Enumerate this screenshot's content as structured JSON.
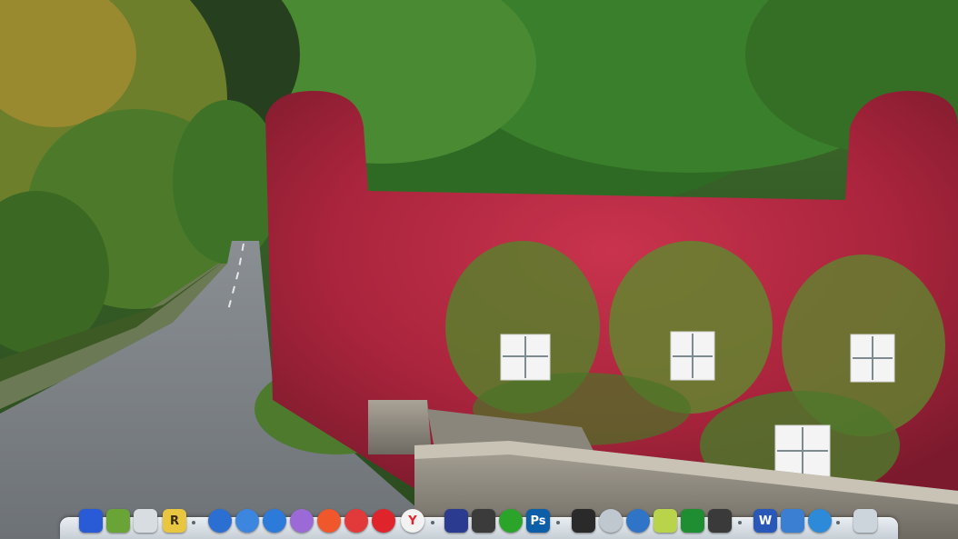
{
  "desktop": {
    "wallpaper": "ivy-covered-cottage-by-road"
  },
  "dock": {
    "items": [
      {
        "icon": "finder-icon",
        "color": "#2a5bd7"
      },
      {
        "icon": "gourd-icon",
        "color": "#6aa336"
      },
      {
        "icon": "mail-icon",
        "color": "#d8dde2"
      },
      {
        "icon": "r-app-icon",
        "color": "#e9c640",
        "glyph": "R"
      },
      {
        "icon": "firefox-icon",
        "color": "#2b6fd2"
      },
      {
        "icon": "globe-browser-icon",
        "color": "#3d86e0"
      },
      {
        "icon": "safari-icon",
        "color": "#2c7ad9"
      },
      {
        "icon": "tor-browser-icon",
        "color": "#9b6ad6"
      },
      {
        "icon": "brave-icon",
        "color": "#f0572a"
      },
      {
        "icon": "vivaldi-icon",
        "color": "#e23a3a"
      },
      {
        "icon": "opera-icon",
        "color": "#e0242b"
      },
      {
        "icon": "yandex-icon",
        "color": "#f2f2f2",
        "glyph": "Y"
      },
      {
        "icon": "save-disk-icon",
        "color": "#2b3b8f"
      },
      {
        "icon": "camera-app-icon",
        "color": "#3b3b3b"
      },
      {
        "icon": "green-ball-icon",
        "color": "#2aa52a"
      },
      {
        "icon": "photoshop-icon",
        "color": "#0d5ea8",
        "glyph": "Ps"
      },
      {
        "icon": "clapper-icon",
        "color": "#2a2a2a"
      },
      {
        "icon": "app-store-icon",
        "color": "#bfc7cf"
      },
      {
        "icon": "earth-icon",
        "color": "#2f74c7"
      },
      {
        "icon": "pencil-icon",
        "color": "#b9d34a"
      },
      {
        "icon": "jamaica-flag-icon",
        "color": "#1f8d32"
      },
      {
        "icon": "screenshot-icon",
        "color": "#3a3a3a"
      },
      {
        "icon": "word-icon",
        "color": "#2a58b8",
        "glyph": "W"
      },
      {
        "icon": "document-icon",
        "color": "#3a7fd1"
      },
      {
        "icon": "airline-icon",
        "color": "#2c8ad8"
      },
      {
        "icon": "trash-icon",
        "color": "#cdd5dc"
      }
    ]
  }
}
